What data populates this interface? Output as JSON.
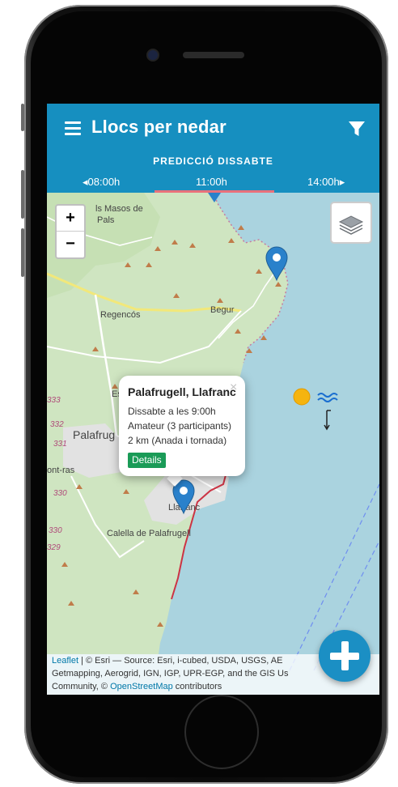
{
  "app": {
    "title": "Llocs per nedar"
  },
  "forecast": {
    "title": "PREDICCIÓ DISSABTE",
    "prev_time": "◂08:00h",
    "current_time": "11:00h",
    "next_time": "14:00h▸"
  },
  "map": {
    "zoom_in": "+",
    "zoom_out": "−",
    "places": [
      "ls Masos de",
      "Pals",
      "Regencós",
      "Begur",
      "Es",
      "Palafrug",
      "ont-ras",
      "Llafranc",
      "Calella de Palafrugell"
    ],
    "elevations": [
      "333",
      "332",
      "331",
      "330",
      "330",
      "329"
    ],
    "colors": {
      "sea": "#aad3df",
      "land": "#cfe5c1",
      "town": "#dddddd",
      "marker": "#2a81cb",
      "route": "#cc3344"
    }
  },
  "popup": {
    "title": "Palafrugell, Llafranc",
    "close": "×",
    "date": "Dissabte a les 9:00h",
    "level": "Amateur (3 participants)",
    "distance": "2 km (Anada i tornada)",
    "details_label": "Details"
  },
  "attribution": {
    "leaflet": "Leaflet",
    "text1": " | © Esri — Source: Esri, i-cubed, USDA, USGS, AE",
    "text2": "Getmapping, Aerogrid, IGN, IGP, UPR-EGP, and the GIS Us",
    "text3": "Community, © ",
    "osm": "OpenStreetMap",
    "text4": " contributors"
  },
  "icons": {
    "menu": "menu-icon",
    "filter": "filter-icon",
    "layers": "layers-icon",
    "sun": "sun-icon",
    "waves": "waves-icon",
    "add": "plus-icon"
  },
  "theme": {
    "primary": "#168fc0",
    "accent": "#e9717b",
    "details_green": "#1a9b57"
  }
}
